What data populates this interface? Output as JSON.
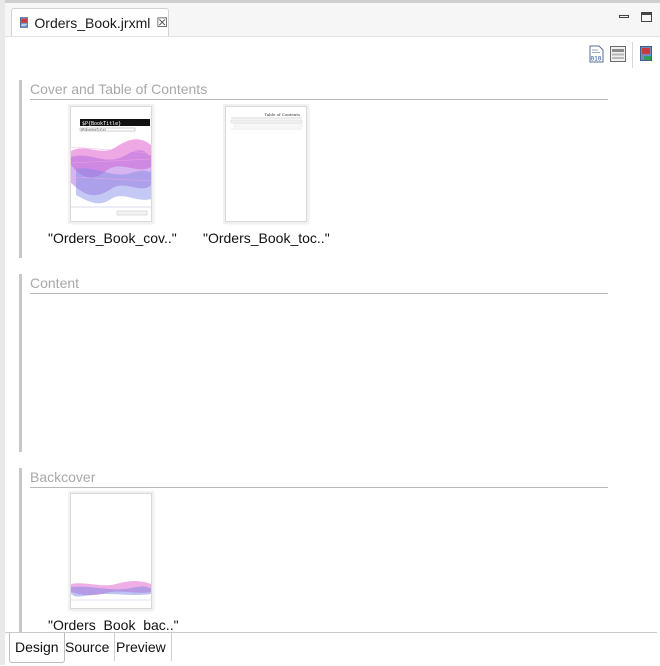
{
  "editor": {
    "tab_title": "Orders_Book.jrxml",
    "close_symbol": "☒"
  },
  "toolbar": {
    "icons": [
      "datasource-icon",
      "band-layout-icon",
      "book-export-icon"
    ]
  },
  "sections": [
    {
      "title": "Cover and Table of Contents",
      "parts": [
        {
          "caption": "\"Orders_Book_cov..\"",
          "kind": "cover",
          "thumb_text": "$P{BookTitle}",
          "thumb_subtext": "$P{BookSubTitle}"
        },
        {
          "caption": "\"Orders_Book_toc..\"",
          "kind": "toc",
          "thumb_text": "Table of Contents"
        }
      ]
    },
    {
      "title": "Content",
      "parts": []
    },
    {
      "title": "Backcover",
      "parts": [
        {
          "caption": "\"Orders_Book_bac..\"",
          "kind": "back"
        }
      ]
    }
  ],
  "bottom_tabs": [
    "Design",
    "Source",
    "Preview"
  ],
  "active_bottom_tab": "Design",
  "colors": {
    "section_title": "#a8a8a8",
    "wave_pink": "#e060c0",
    "wave_blue": "#7a7ad8",
    "title_bar": "#111111"
  }
}
